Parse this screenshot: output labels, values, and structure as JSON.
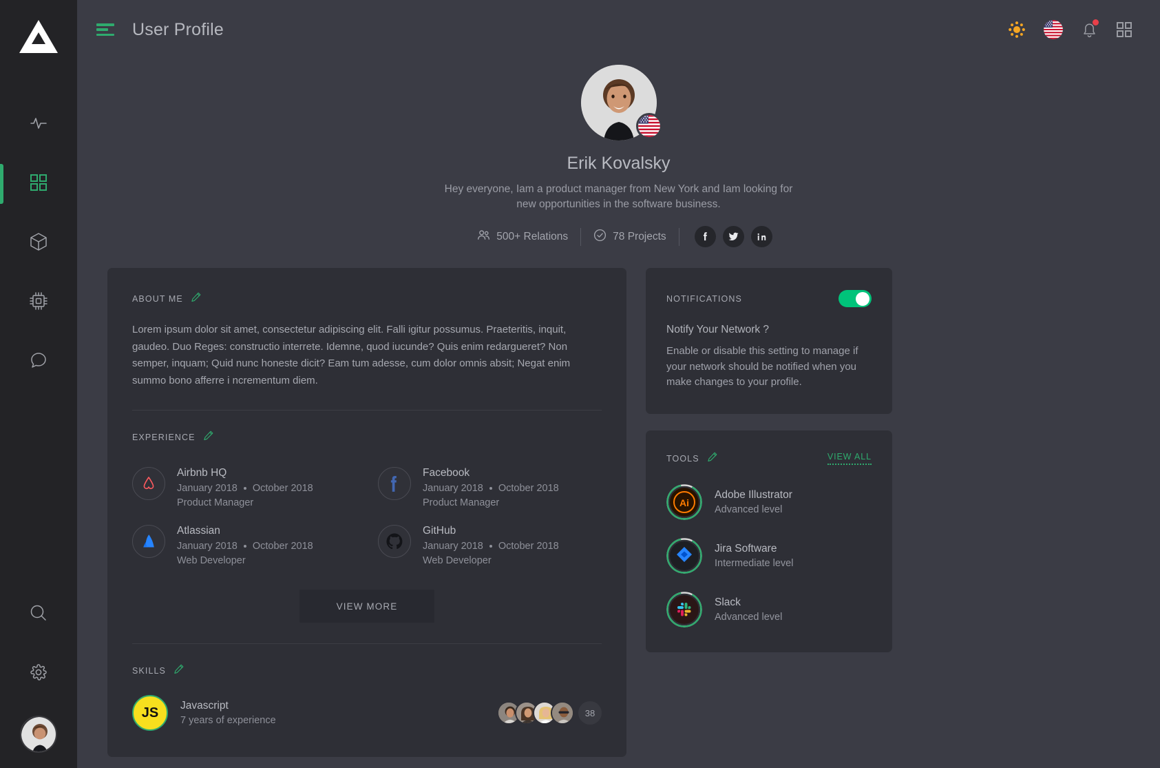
{
  "colors": {
    "accent_green": "#2fab6e",
    "toggle_on": "#00c37a",
    "page_bg": "#3b3c45",
    "card_bg": "#2e2f36",
    "sidebar_bg": "#232326",
    "notification_dot": "#e8404a",
    "sun_icon": "#f5a623",
    "js_yellow": "#f7df1e"
  },
  "sidebar": {
    "logo_name": "triangle-logo",
    "items": [
      {
        "icon": "activity-pulse-icon",
        "label": "Activity",
        "active": false
      },
      {
        "icon": "grid-dashboard-icon",
        "label": "Dashboard",
        "active": true
      },
      {
        "icon": "cube-box-icon",
        "label": "Products",
        "active": false
      },
      {
        "icon": "cpu-chip-icon",
        "label": "Devices",
        "active": false
      },
      {
        "icon": "chat-bubble-icon",
        "label": "Messages",
        "active": false
      }
    ],
    "bottom_items": [
      {
        "icon": "search-icon",
        "label": "Search"
      },
      {
        "icon": "gear-settings-icon",
        "label": "Settings"
      }
    ],
    "avatar_name": "user-avatar"
  },
  "topbar": {
    "menu_icon": "hamburger-menu-icon",
    "title": "User Profile",
    "actions": [
      {
        "icon": "sun-brightness-icon",
        "label": "Theme"
      },
      {
        "icon": "us-flag-icon",
        "label": "Language"
      },
      {
        "icon": "bell-notification-icon",
        "label": "Notifications",
        "has_badge": true
      },
      {
        "icon": "grid-apps-icon",
        "label": "Apps"
      }
    ]
  },
  "profile": {
    "avatar_name": "profile-avatar",
    "flag": "us-flag-icon",
    "name": "Erik Kovalsky",
    "bio": "Hey everyone,  Iam a product manager from New York and Iam looking for new opportunities in the software business.",
    "stats": [
      {
        "icon": "people-icon",
        "value": "500+ Relations"
      },
      {
        "icon": "check-circle-icon",
        "value": "78 Projects"
      }
    ],
    "socials": [
      {
        "icon": "facebook-icon",
        "label": "Facebook"
      },
      {
        "icon": "twitter-icon",
        "label": "Twitter"
      },
      {
        "icon": "linkedin-icon",
        "label": "LinkedIn"
      }
    ]
  },
  "about": {
    "title": "ABOUT ME",
    "edit_icon": "pencil-edit-icon",
    "text": "Lorem ipsum dolor sit amet, consectetur adipiscing elit. Falli igitur possumus. Praeteritis, inquit, gaudeo. Duo Reges: constructio interrete. Idemne, quod iucunde? Quis enim redargueret? Non semper, inquam; Quid nunc honeste dicit? Eam tum adesse, cum dolor omnis absit; Negat enim summo bono afferre i ncrementum diem."
  },
  "experience": {
    "title": "EXPERIENCE",
    "edit_icon": "pencil-edit-icon",
    "items": [
      {
        "logo": "airbnb-icon",
        "company": "Airbnb HQ",
        "start": "January 2018",
        "end": "October 2018",
        "role": "Product Manager"
      },
      {
        "logo": "facebook-icon",
        "company": "Facebook",
        "start": "January 2018",
        "end": "October 2018",
        "role": "Product Manager"
      },
      {
        "logo": "atlassian-icon",
        "company": "Atlassian",
        "start": "January 2018",
        "end": "October 2018",
        "role": "Web Developer"
      },
      {
        "logo": "github-icon",
        "company": "GitHub",
        "start": "January 2018",
        "end": "October 2018",
        "role": "Web Developer"
      }
    ],
    "view_more_label": "VIEW MORE"
  },
  "skills": {
    "title": "SKILLS",
    "edit_icon": "pencil-edit-icon",
    "items": [
      {
        "badge": "JS",
        "name": "Javascript",
        "experience": "7 years of experience",
        "endorsers": [
          "avatar-1",
          "avatar-2",
          "avatar-3",
          "avatar-4"
        ],
        "more_count": "38"
      }
    ]
  },
  "notifications": {
    "title": "NOTIFICATIONS",
    "toggle_on": true,
    "question": "Notify Your Network ?",
    "description": "Enable or disable this setting to manage if your network should be notified when you make changes to your profile."
  },
  "tools": {
    "title": "TOOLS",
    "edit_icon": "pencil-edit-icon",
    "view_all_label": "VIEW ALL",
    "items": [
      {
        "icon": "adobe-illustrator-icon",
        "name": "Adobe Illustrator",
        "level": "Advanced level",
        "progress": 88
      },
      {
        "icon": "jira-software-icon",
        "name": "Jira Software",
        "level": "Intermediate level",
        "progress": 88
      },
      {
        "icon": "slack-icon",
        "name": "Slack",
        "level": "Advanced level",
        "progress": 88
      }
    ]
  }
}
